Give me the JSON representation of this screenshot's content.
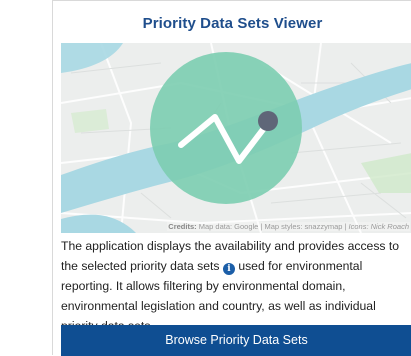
{
  "card": {
    "title": "Priority Data Sets Viewer",
    "credits": {
      "label": "Credits:",
      "map_data": "Map data: Google",
      "map_styles": "Map styles: snazzymap",
      "icons": "Icons: Nick Roach"
    },
    "description": {
      "part1": "The application displays the availability and provides access to the selected priority data sets",
      "info_glyph": "i",
      "part2": "used for environmental reporting. It allows filtering by environmental domain, environmental legislation and country, as well as individual priority data sets."
    },
    "browse_button": "Browse Priority Data Sets"
  },
  "colors": {
    "title": "#1f4e8c",
    "button": "#0f4e92",
    "water": "#a6d7e2",
    "green_circle": "#7ccdb0",
    "line_icon": "#ffffff",
    "marker": "#5f6678"
  },
  "icons": [
    "info-icon",
    "trend-line-icon",
    "marker-dot-icon"
  ]
}
